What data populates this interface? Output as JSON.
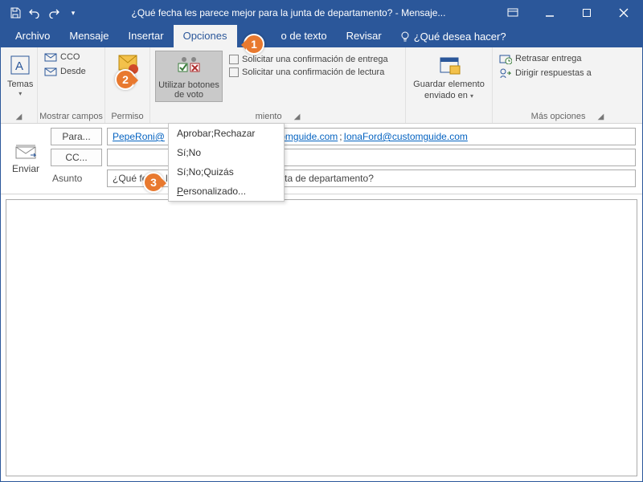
{
  "title": "¿Qué fecha les parece mejor para la junta de departamento?  -  Mensaje...",
  "tabs": {
    "archivo": "Archivo",
    "mensaje": "Mensaje",
    "insertar": "Insertar",
    "opciones": "Opciones",
    "formato": "o de texto",
    "revisar": "Revisar",
    "tell": "¿Qué desea hacer?"
  },
  "groups": {
    "temas": {
      "label": "Temas",
      "big": "Temas"
    },
    "campos": {
      "label": "Mostrar campos",
      "cco": "CCO",
      "desde": "Desde"
    },
    "permiso": {
      "label": "Permiso",
      "big": "P"
    },
    "seguimiento": {
      "label_suffix": "miento",
      "voting": "Utilizar botones de voto",
      "delivery": "Solicitar una confirmación de entrega",
      "read": "Solicitar una confirmación de lectura"
    },
    "guardar": {
      "line1": "Guardar elemento",
      "line2": "enviado en"
    },
    "mas": {
      "label": "Más opciones",
      "retrasar": "Retrasar entrega",
      "dirigir": "Dirigir respuestas a"
    }
  },
  "voting_menu": {
    "approve": "Aprobar;Rechazar",
    "yesno": "Sí;No",
    "yesnomaybe": "Sí;No;Quizás",
    "custom": "Personalizado..."
  },
  "compose": {
    "send": "Enviar",
    "para": "Para...",
    "cc": "CC...",
    "asunto": "Asunto",
    "to_value_1": "PepeRoni@",
    "to_value_2": "stomguide.com",
    "to_value_3": "IonaFord@customguide.com",
    "subject_value": "¿Qué fecha les parece mejor para la junta de departamento?"
  },
  "callouts": {
    "c1": "1",
    "c2": "2",
    "c3": "3"
  }
}
